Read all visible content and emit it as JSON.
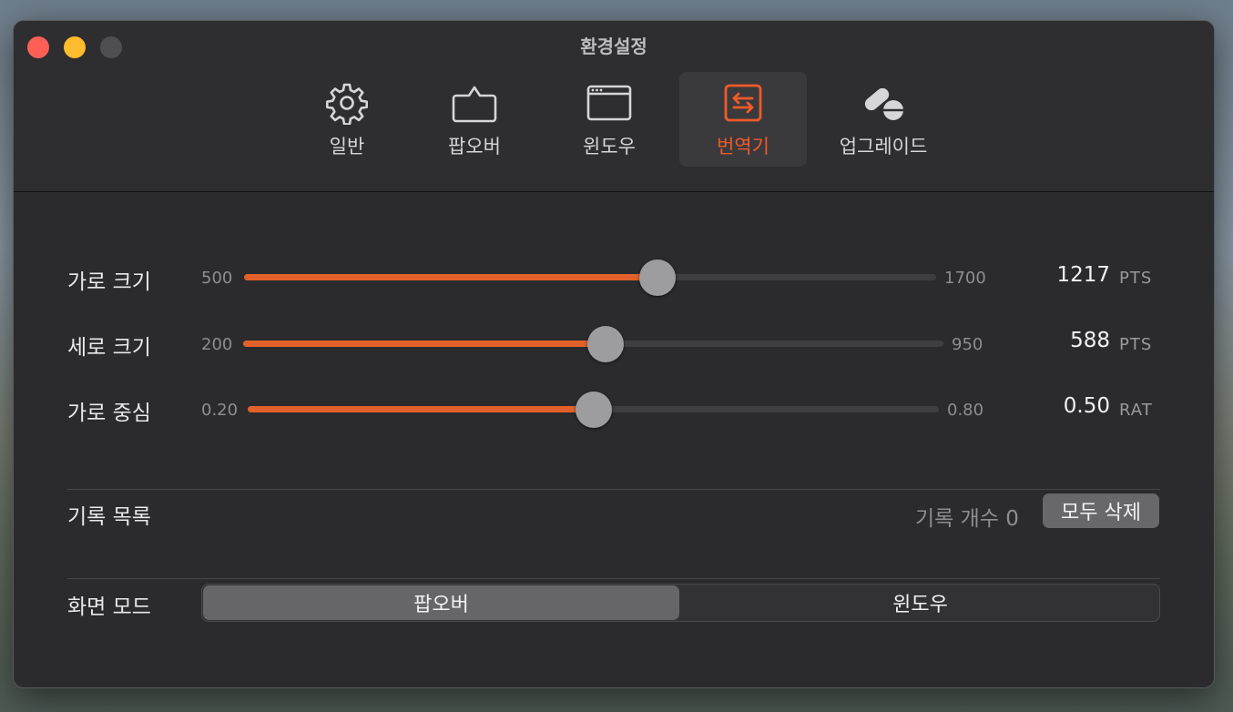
{
  "window": {
    "title": "환경설정"
  },
  "tabs": [
    {
      "label": "일반",
      "icon": "gear-icon"
    },
    {
      "label": "팝오버",
      "icon": "speech-bubble-icon"
    },
    {
      "label": "윈도우",
      "icon": "window-icon"
    },
    {
      "label": "번역기",
      "icon": "translate-icon",
      "active": true
    },
    {
      "label": "업그레이드",
      "icon": "pill-icon"
    }
  ],
  "accent_color": "#e2612a",
  "sliders": [
    {
      "label": "가로 크기",
      "min": "500",
      "max": "1700",
      "value": "1217",
      "unit": "PTS",
      "fraction": 0.5975
    },
    {
      "label": "세로 크기",
      "min": "200",
      "max": "950",
      "value": "588",
      "unit": "PTS",
      "fraction": 0.5173
    },
    {
      "label": "가로 중심",
      "min": "0.20",
      "max": "0.80",
      "value": "0.50",
      "unit": "RAT",
      "fraction": 0.5
    }
  ],
  "history": {
    "label": "기록 목록",
    "count_text": "기록 개수 0",
    "delete_label": "모두 삭제"
  },
  "display_mode": {
    "label": "화면 모드",
    "options": [
      "팝오버",
      "윈도우"
    ],
    "selected": "팝오버"
  }
}
